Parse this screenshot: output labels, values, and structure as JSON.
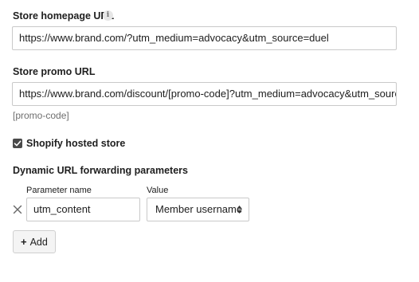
{
  "store_homepage": {
    "label": "Store homepage URL",
    "info_icon": "info-icon",
    "value": "https://www.brand.com/?utm_medium=advocacy&utm_source=duel"
  },
  "store_promo": {
    "label": "Store promo URL",
    "value": "https://www.brand.com/discount/[promo-code]?utm_medium=advocacy&utm_source=duel",
    "hint": "[promo-code]"
  },
  "shopify": {
    "label": "Shopify hosted store",
    "checked": true
  },
  "forwarding": {
    "label": "Dynamic URL forwarding parameters",
    "param_name_header": "Parameter name",
    "value_header": "Value",
    "rows": [
      {
        "parameter": "utm_content",
        "value": "Member username"
      }
    ],
    "remove_icon": "close-icon",
    "add_label": "Add"
  }
}
